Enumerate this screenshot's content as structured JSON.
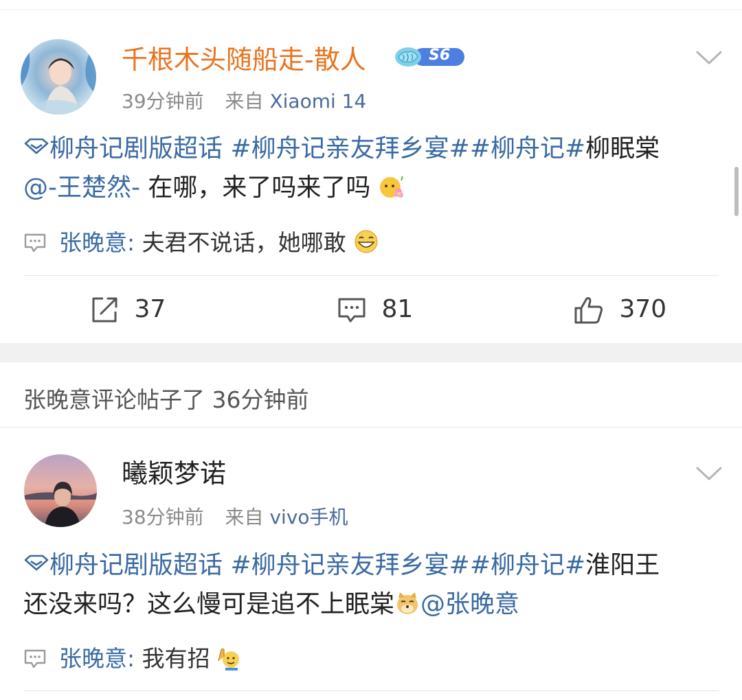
{
  "posts": [
    {
      "author": "千根木头随船走-散人",
      "level_badge": "S6",
      "time": "39分钟前",
      "from_label": "来自",
      "source": "Xiaomi 14",
      "topic_tag": "柳舟记剧版超话",
      "hashtag1": "#柳舟记亲友拜乡宴#",
      "hashtag2": "#柳舟记#",
      "text_after_tags": "柳眠棠",
      "mention": "@-王楚然-",
      "text_end": " 在哪，来了吗来了吗",
      "comment_user": "张晚意",
      "comment_sep": ": ",
      "comment_text": "夫君不说话，她哪敢",
      "reposts": "37",
      "comments": "81",
      "likes": "370"
    },
    {
      "activity": "张晚意评论帖子了 36分钟前",
      "author": "曦颖梦诺",
      "time": "38分钟前",
      "from_label": "来自",
      "source": "vivo手机",
      "topic_tag": "柳舟记剧版超话",
      "hashtag1": "#柳舟记亲友拜乡宴#",
      "hashtag2": "#柳舟记#",
      "text_after_tags": "淮阳王",
      "text_line2": "还没来吗？这么慢可是追不上眠棠",
      "mention": "@张晚意",
      "comment_user": "张晚意",
      "comment_sep": ": ",
      "comment_text": "我有招"
    }
  ],
  "icons": {
    "topic": "diamond-icon",
    "comment": "comment-bubble-icon",
    "repost": "repost-icon",
    "like": "thumbs-up-icon",
    "menu": "chevron-down-icon"
  },
  "colors": {
    "author_orange": "#e8741f",
    "link_blue": "#3a6aa3",
    "meta_gray": "#8a8a8a"
  }
}
